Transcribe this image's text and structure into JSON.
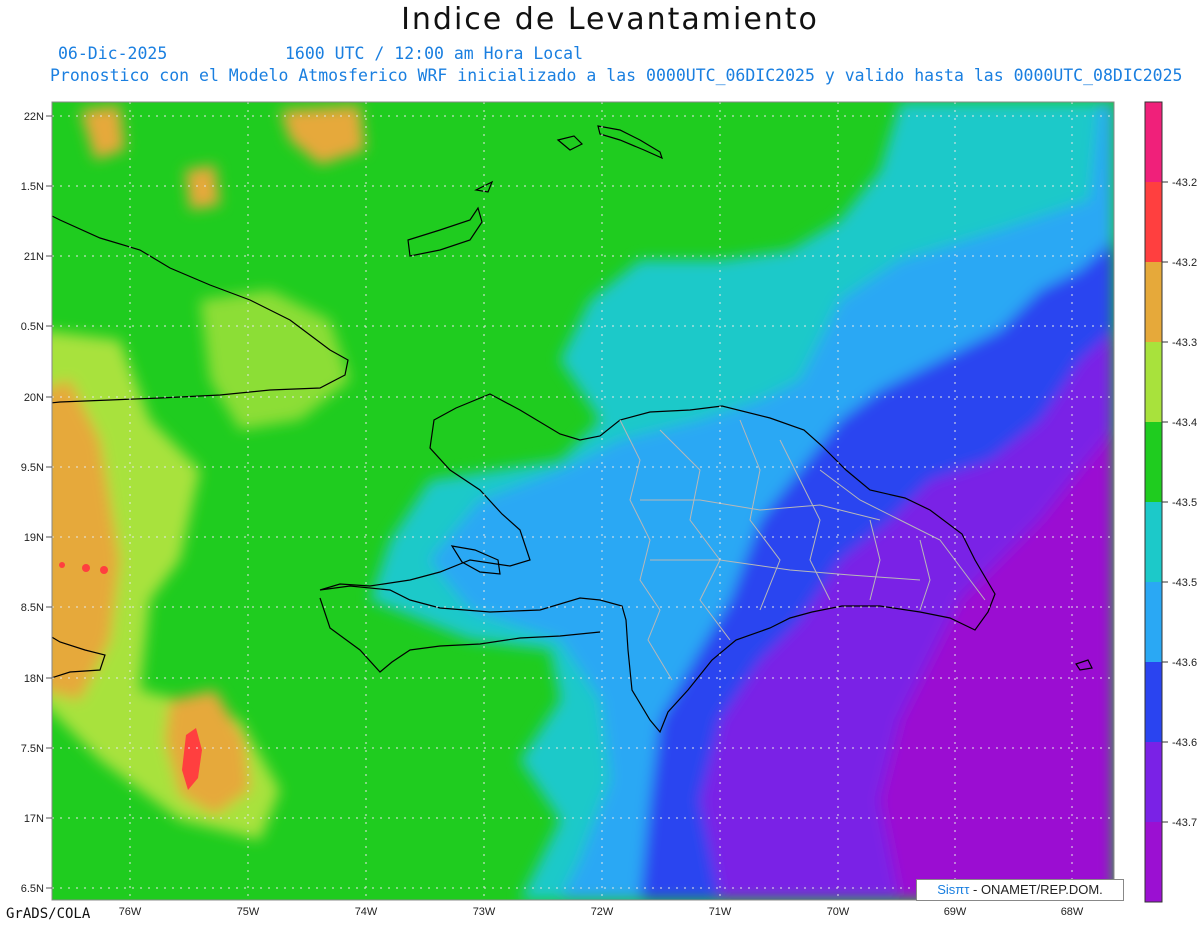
{
  "header": {
    "title": "Indice de Levantamiento",
    "date": "06-Dic-2025",
    "time": "1600 UTC / 12:00 am Hora Local",
    "subtitle": "Pronostico con el Modelo Atmosferico WRF inicializado a las 0000UTC_06DIC2025 y valido hasta las  0000UTC_08DIC2025"
  },
  "map": {
    "lat_labels": [
      "22N",
      "1.5N",
      "21N",
      "0.5N",
      "20N",
      "9.5N",
      "19N",
      "8.5N",
      "18N",
      "7.5N",
      "17N",
      "6.5N"
    ],
    "lon_labels": [
      "76W",
      "75W",
      "74W",
      "73W",
      "72W",
      "71W",
      "70W",
      "69W",
      "68W"
    ],
    "field_colors": {
      "yellow_green": "#a8e23c",
      "green": "#1fcc1f",
      "cyan": "#1cc9c9",
      "light_blue": "#2aa8f4",
      "blue": "#2a44f0",
      "violet": "#7a22e6",
      "purple": "#9b10d2",
      "orange": "#e6a93a",
      "red": "#ff3f3f"
    }
  },
  "colorbar": {
    "colors": [
      "#f0207a",
      "#ff3f3f",
      "#e6a93a",
      "#a8e23c",
      "#1fcc1f",
      "#1cc9c9",
      "#2aa8f4",
      "#2a44f0",
      "#7a22e6",
      "#9b10d2"
    ],
    "labels": [
      "-43.2",
      "-43.2",
      "-43.3",
      "-43.4",
      "-43.5",
      "-43.5",
      "-43.6",
      "-43.6",
      "-43.7"
    ]
  },
  "credit": {
    "logo": "Sisπτ",
    "text": " - ONAMET/REP.DOM."
  },
  "footer": {
    "software": "GrADS/COLA"
  }
}
